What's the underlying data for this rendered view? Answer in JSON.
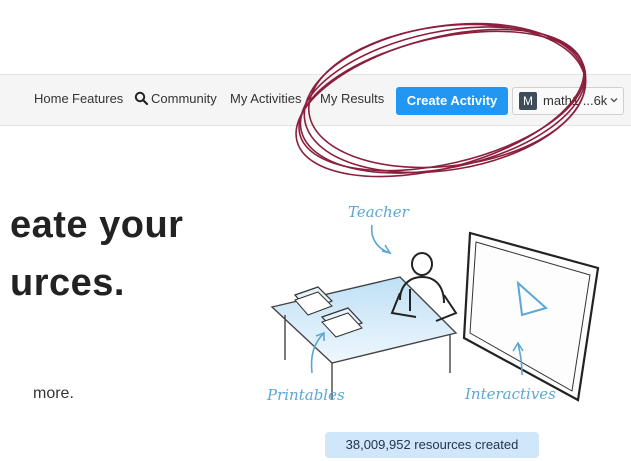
{
  "nav": {
    "home": "Home",
    "features": "Features",
    "community": "Community",
    "my_activities": "My Activities",
    "my_results": "My Results",
    "create_activity": "Create Activity",
    "user": {
      "initial": "M",
      "name": "math1 ...6k"
    }
  },
  "hero": {
    "line1": "eate your",
    "line2": "urces.",
    "more": "more."
  },
  "illustration": {
    "teacher": "Teacher",
    "printables": "Printables",
    "interactives": "Interactives"
  },
  "stats": {
    "resources_created": "38,009,952 resources created"
  },
  "colors": {
    "accent": "#2196f3",
    "annotation": "#8b1f3d",
    "sketch_blue": "#5aa7d6"
  }
}
